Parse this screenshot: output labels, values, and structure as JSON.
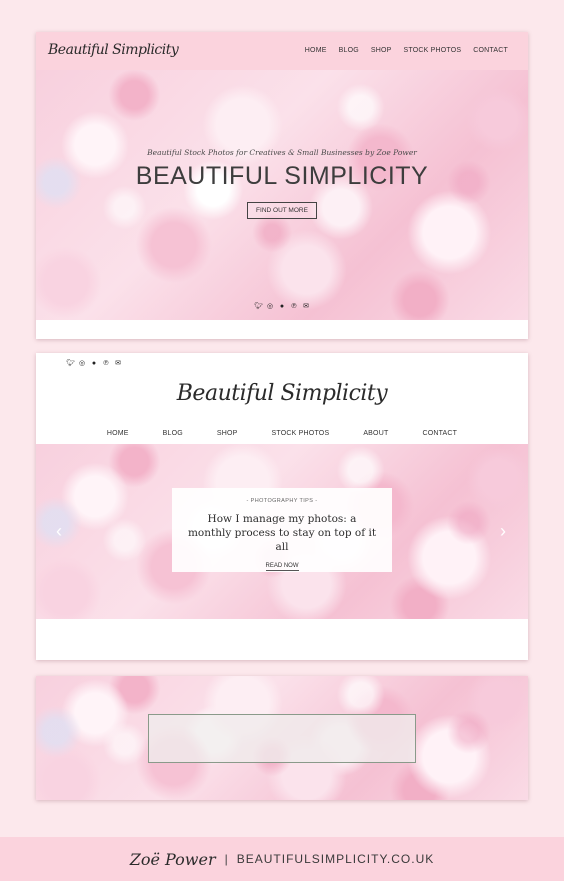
{
  "card1": {
    "logo": "Beautiful Simplicity",
    "nav": [
      "HOME",
      "BLOG",
      "SHOP",
      "STOCK PHOTOS",
      "CONTACT"
    ],
    "hero": {
      "tagline": "Beautiful Stock Photos for Creatives & Small Businesses by Zoe Power",
      "title": "BEAUTIFUL SIMPLICITY",
      "button": "FIND OUT MORE"
    },
    "social_icons": [
      "twitter-icon",
      "instagram-icon",
      "flickr-icon",
      "pinterest-icon",
      "email-icon"
    ]
  },
  "card2": {
    "social_icons": [
      "twitter-icon",
      "instagram-icon",
      "flickr-icon",
      "pinterest-icon",
      "email-icon"
    ],
    "logo": "Beautiful Simplicity",
    "nav": [
      "HOME",
      "BLOG",
      "SHOP",
      "STOCK PHOTOS",
      "ABOUT",
      "CONTACT"
    ],
    "post": {
      "category": "- PHOTOGRAPHY TIPS -",
      "title": "How I manage my photos: a monthly process to stay on top of it all",
      "read_more": "READ NOW"
    },
    "arrows": {
      "prev": "‹",
      "next": "›"
    }
  },
  "footer": {
    "signature": "Zoë Power",
    "separator": "|",
    "url": "BEAUTIFULSIMPLICITY.CO.UK"
  },
  "colors": {
    "page_bg": "#fce8ec",
    "header_pink": "#fbd3dd",
    "text_dark": "#3d3d3d"
  }
}
